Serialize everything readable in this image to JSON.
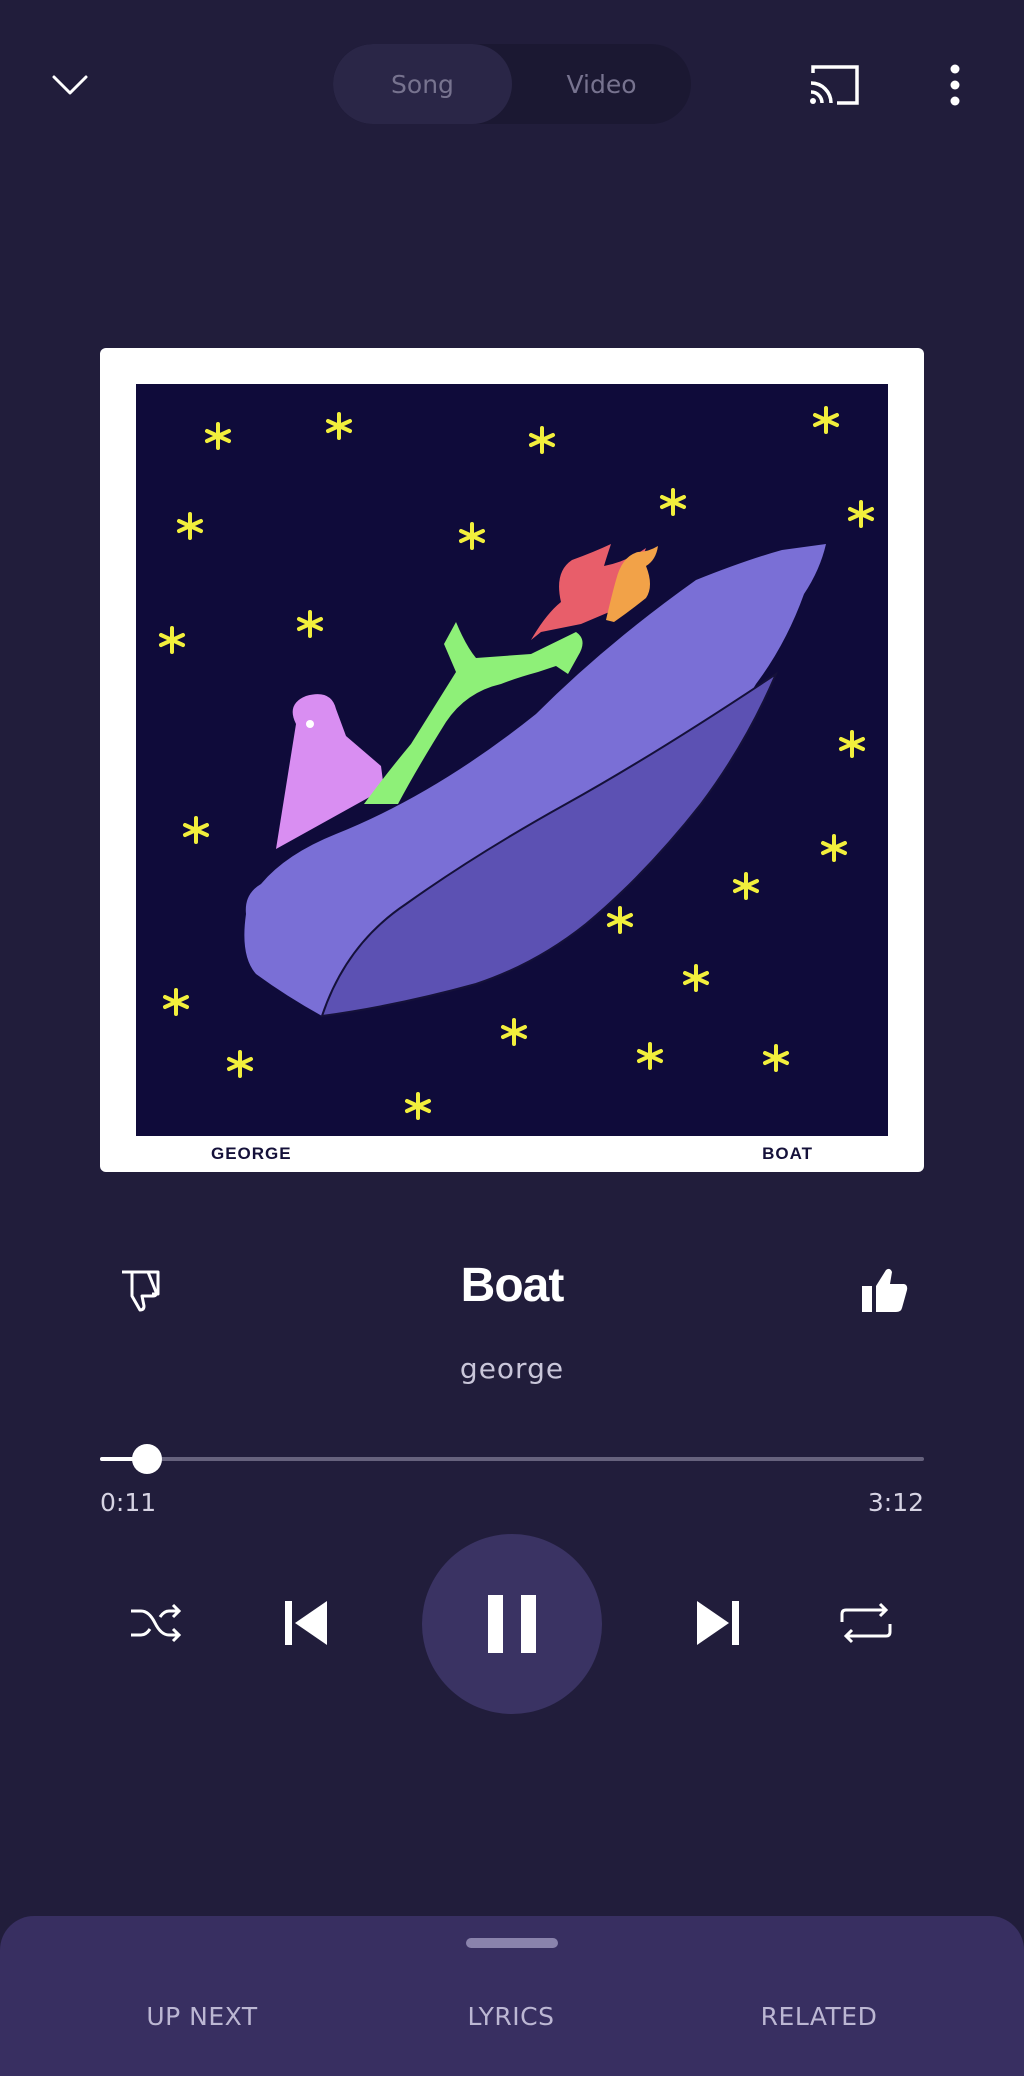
{
  "header": {
    "toggle": {
      "song_label": "Song",
      "video_label": "Video",
      "selected": "Song"
    },
    "icons": [
      "chevron-down-icon",
      "cast-icon",
      "more-vertical-icon"
    ]
  },
  "album": {
    "caption_left": "GEORGE",
    "caption_right": "BOAT"
  },
  "track": {
    "title": "Boat",
    "artist": "george",
    "elapsed": "0:11",
    "duration": "3:12",
    "progress_fraction": 0.057
  },
  "controls": {
    "icons": [
      "shuffle-icon",
      "skip-previous-icon",
      "pause-icon",
      "skip-next-icon",
      "repeat-icon",
      "thumbs-down-icon",
      "thumbs-up-icon"
    ]
  },
  "bottom_sheet": {
    "tabs": [
      "UP NEXT",
      "LYRICS",
      "RELATED"
    ]
  },
  "colors": {
    "background": "#211d3b",
    "play_button": "#3a3363",
    "sheet": "#382f61",
    "album_bg": "#0f0b3a",
    "boat": "#7a6fd6",
    "star": "#f2ef3c"
  }
}
